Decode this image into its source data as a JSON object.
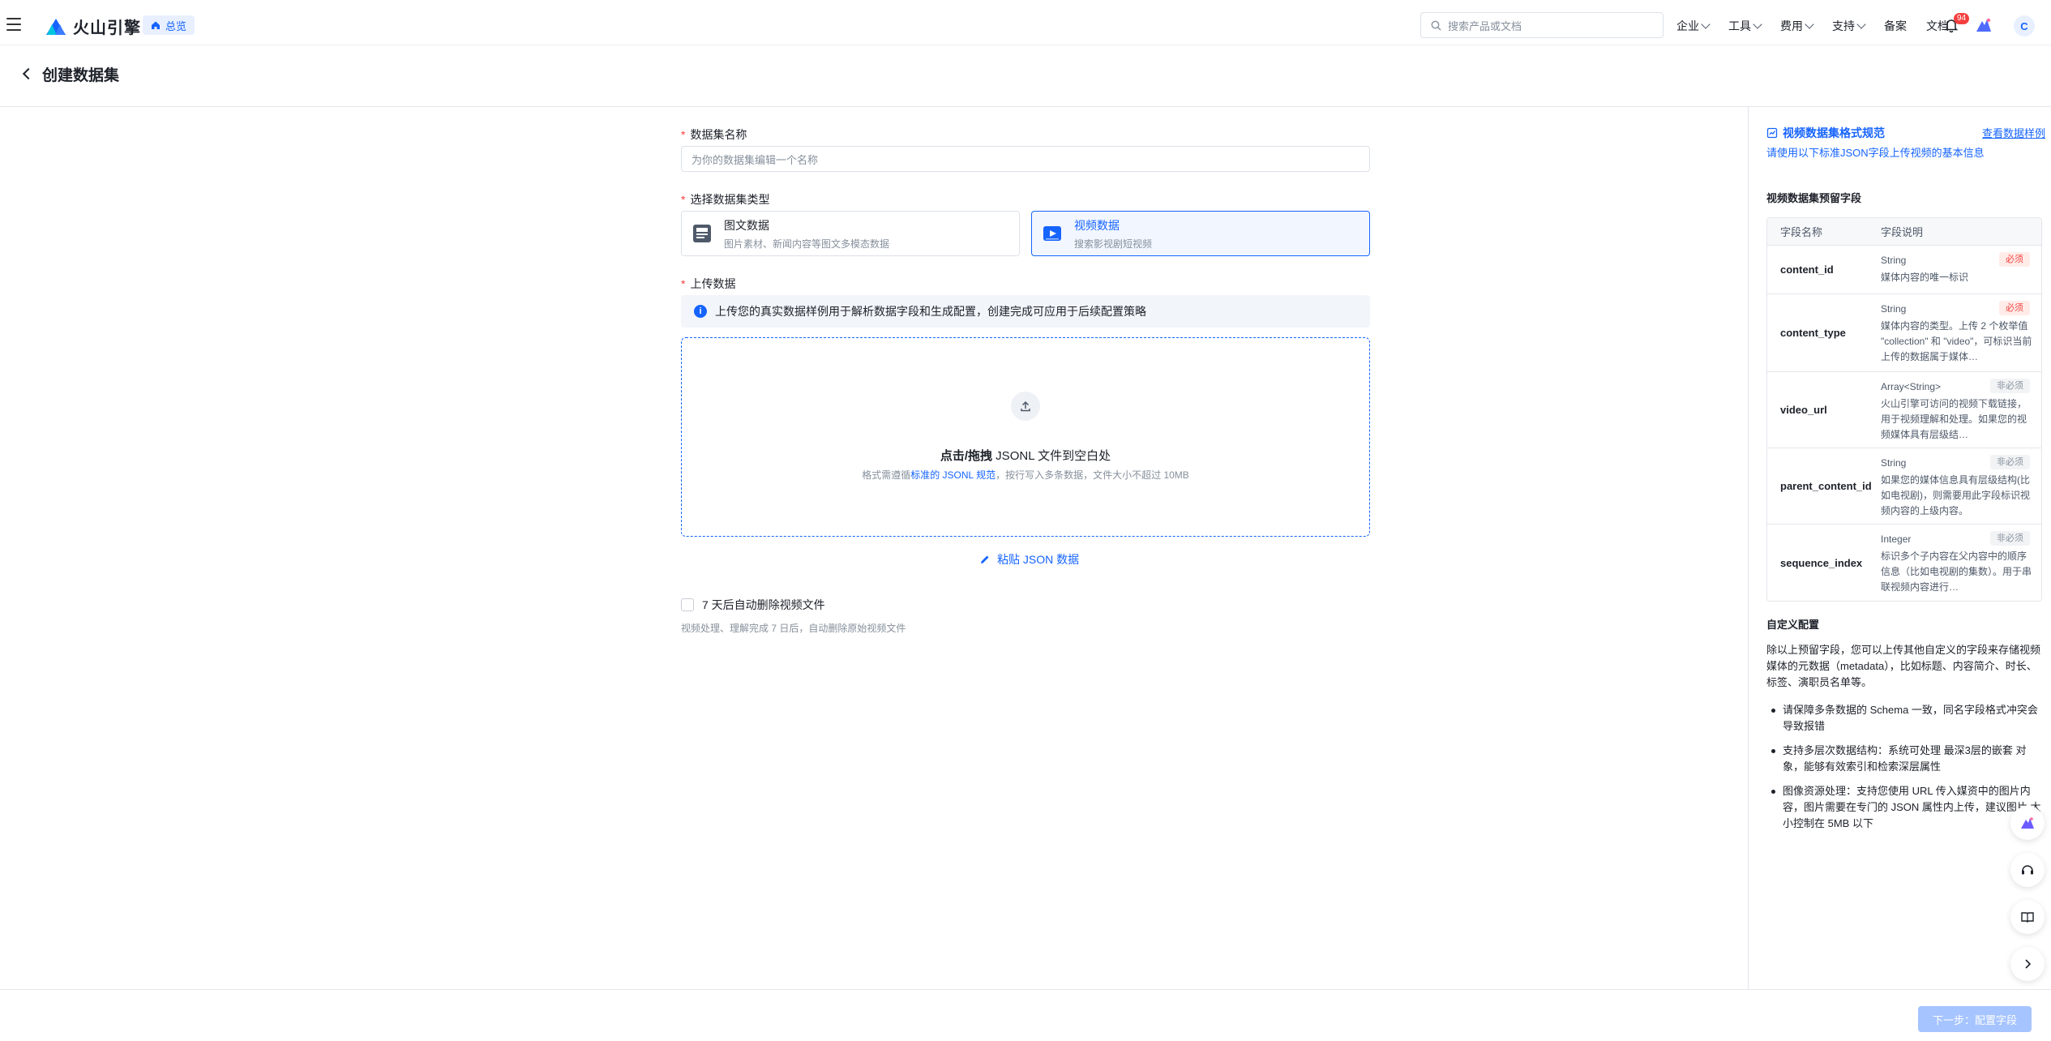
{
  "topbar": {
    "brand": "火山引擎",
    "home_chip": "总览",
    "search_placeholder": "搜索产品或文档",
    "nav": [
      "企业",
      "工具",
      "费用",
      "支持"
    ],
    "nav_plain": [
      "备案",
      "文档"
    ],
    "badge_count": "94",
    "avatar_letter": "C"
  },
  "page": {
    "title": "创建数据集"
  },
  "form": {
    "name_label": "数据集名称",
    "name_placeholder": "为你的数据集编辑一个名称",
    "type_label": "选择数据集类型",
    "types": [
      {
        "name": "图文数据",
        "desc": "图片素材、新闻内容等图文多模态数据",
        "selected": false
      },
      {
        "name": "视频数据",
        "desc": "搜索影视剧短视频",
        "selected": true
      }
    ],
    "upload_label": "上传数据",
    "info_text": "上传您的真实数据样例用于解析数据字段和生成配置，创建完成可应用于后续配置策略",
    "drop_title_bold": "点击/拖拽",
    "drop_title_rest": " JSONL 文件到空白处",
    "drop_hint_prefix": "格式需遵循",
    "drop_hint_link": "标准的 JSONL 规范",
    "drop_hint_suffix": "，按行写入多条数据，文件大小不超过 10MB",
    "paste_label": "粘贴 JSON 数据",
    "auto_delete_label": "7 天后自动删除视频文件",
    "auto_delete_hint": "视频处理、理解完成 7 日后，自动删除原始视频文件"
  },
  "right_panel": {
    "title": "视频数据集格式规范",
    "example_link": "查看数据样例",
    "subtitle": "请使用以下标准JSON字段上传视频的基本信息",
    "reserved_title": "视频数据集预留字段",
    "col_name": "字段名称",
    "col_desc": "字段说明",
    "fields": [
      {
        "name": "content_id",
        "type": "String",
        "tag": "必须",
        "required": true,
        "desc": "媒体内容的唯一标识"
      },
      {
        "name": "content_type",
        "type": "String",
        "tag": "必须",
        "required": true,
        "desc": "媒体内容的类型。上传 2 个枚举值 \"collection\" 和 \"video\"，可标识当前上传的数据属于媒体…"
      },
      {
        "name": "video_url",
        "type": "Array<String>",
        "tag": "非必须",
        "required": false,
        "desc": "火山引擎可访问的视频下载链接，用于视频理解和处理。如果您的视频媒体具有层级结…"
      },
      {
        "name": "parent_content_id",
        "type": "String",
        "tag": "非必须",
        "required": false,
        "desc": "如果您的媒体信息具有层级结构(比如电视剧)，则需要用此字段标识视频内容的上级内容。"
      },
      {
        "name": "sequence_index",
        "type": "Integer",
        "tag": "非必须",
        "required": false,
        "desc": "标识多个子内容在父内容中的顺序信息（比如电视剧的集数）。用于串联视频内容进行…"
      }
    ],
    "custom_title": "自定义配置",
    "custom_para": "除以上预留字段，您可以上传其他自定义的字段来存储视频媒体的元数据（metadata），比如标题、内容简介、时长、标签、演职员名单等。",
    "bullets": [
      "请保障多条数据的 Schema 一致，同名字段格式冲突会导致报错",
      "支持多层次数据结构：系统可处理 最深3层的嵌套 对象，能够有效索引和检索深层属性",
      "图像资源处理：支持您使用 URL 传入媒资中的图片内容，图片需要在专门的 JSON 属性内上传，建议图片 大小控制在 5MB 以下"
    ]
  },
  "footer": {
    "next_label": "下一步：配置字段"
  },
  "colors": {
    "accent": "#1664ff",
    "required_tag": "#f53f3f",
    "disabled_button": "#a6c4ff"
  }
}
